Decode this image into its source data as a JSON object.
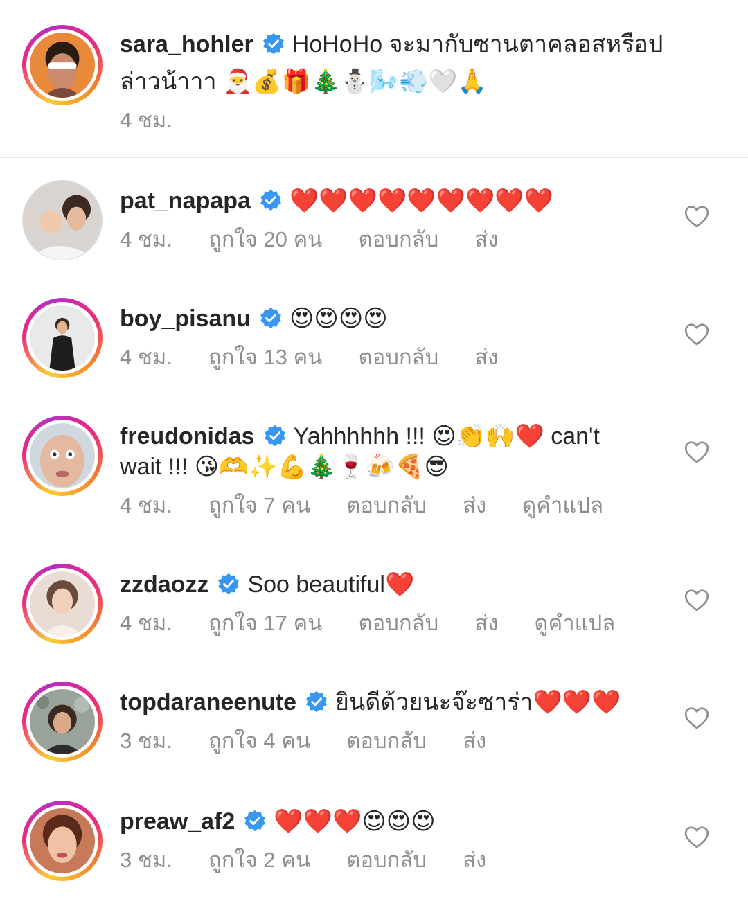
{
  "caption": {
    "username": "sara_hohler",
    "text_line1": "HoHoHo จะมากับซานตาคลอสหรือป",
    "text_line2": "ล่าวน้าาา 🎅💰🎁🎄⛄🌬️💨🤍🙏",
    "time": "4 ชม."
  },
  "comments": [
    {
      "username": "pat_napapa",
      "text": "❤️❤️❤️❤️❤️❤️❤️❤️❤️",
      "time": "4 ชม.",
      "likes": "ถูกใจ 20 คน",
      "reply": "ตอบกลับ",
      "send": "ส่ง"
    },
    {
      "username": "boy_pisanu",
      "text": "😍😍😍😍",
      "time": "4 ชม.",
      "likes": "ถูกใจ 13 คน",
      "reply": "ตอบกลับ",
      "send": "ส่ง"
    },
    {
      "username": "freudonidas",
      "text_line1": "Yahhhhhh !!! 😍👏🙌❤️ can't",
      "text_line2": "wait !!! 😘🫶✨💪🎄🍷🍻🍕😎",
      "time": "4 ชม.",
      "likes": "ถูกใจ 7 คน",
      "reply": "ตอบกลับ",
      "send": "ส่ง",
      "translate": "ดูคำแปล"
    },
    {
      "username": "zzdaozz",
      "text": "Soo beautiful❤️",
      "time": "4 ชม.",
      "likes": "ถูกใจ 17 คน",
      "reply": "ตอบกลับ",
      "send": "ส่ง",
      "translate": "ดูคำแปล"
    },
    {
      "username": "topdaraneenute",
      "text": "ยินดีด้วยนะจ๊ะซาร่า❤️❤️❤️",
      "time": "3 ชม.",
      "likes": "ถูกใจ 4 คน",
      "reply": "ตอบกลับ",
      "send": "ส่ง"
    },
    {
      "username": "preaw_af2",
      "text": "❤️❤️❤️😍😍😍",
      "time": "3 ชม.",
      "likes": "ถูกใจ 2 คน",
      "reply": "ตอบกลับ",
      "send": "ส่ง"
    }
  ],
  "icons": {
    "verified": "verified-badge-icon",
    "like": "heart-outline-icon"
  },
  "colors": {
    "verified": "#3897f0",
    "meta": "#8e8e8e",
    "text": "#262626"
  }
}
